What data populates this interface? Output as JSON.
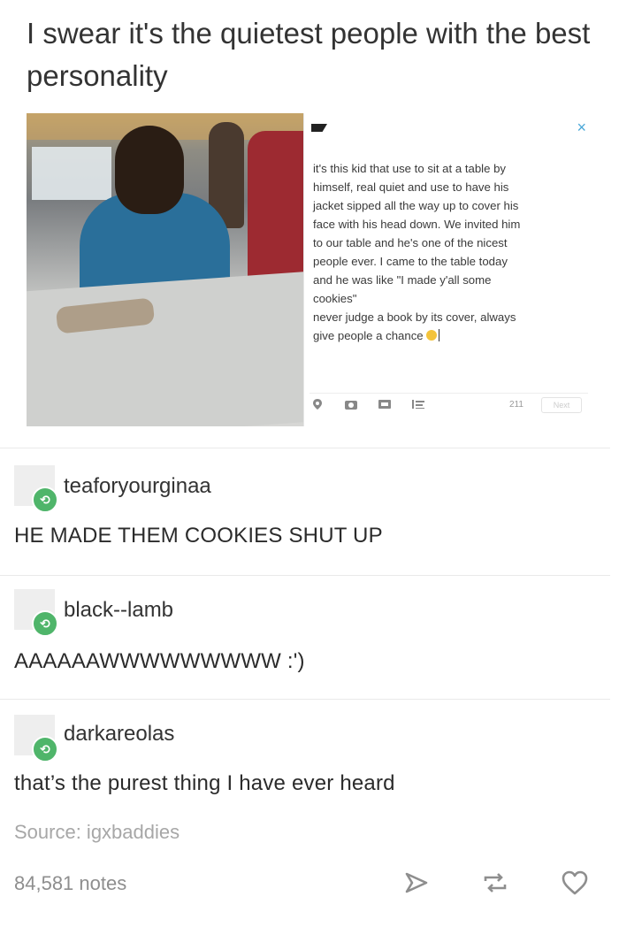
{
  "post": {
    "title": "I swear it's the quietest people with the best personality"
  },
  "embed": {
    "text_lines": [
      "it's this kid that use to sit at a table by",
      "himself, real quiet and use to have his",
      "jacket sipped all the way up to cover his",
      "face with his head down. We invited him",
      "to our table and he's one of the nicest",
      "people ever. I came to the table today",
      "and he was like \"I made y'all some",
      "cookies\"",
      "never judge a book by its cover, always",
      "give people a chance"
    ],
    "char_count": "211",
    "next_label": "Next",
    "close_icon": "×",
    "accent_color": "#4aa8d8"
  },
  "reblogs": [
    {
      "username": "teaforyourginaa",
      "text": "HE MADE THEM COOKIES SHUT UP"
    },
    {
      "username": "black--lamb",
      "text": "AAAAAAWWWWWWWWW :')"
    },
    {
      "username": "darkareolas",
      "text": "that’s the purest thing I have ever heard"
    }
  ],
  "source": "Source: igxbaddies",
  "notes": "84,581 notes",
  "icons": {
    "share": "share-icon",
    "reblog": "reblog-icon",
    "like": "heart-icon"
  },
  "colors": {
    "reblog_badge": "#4fb56a",
    "muted_text": "#8e8e8e"
  }
}
